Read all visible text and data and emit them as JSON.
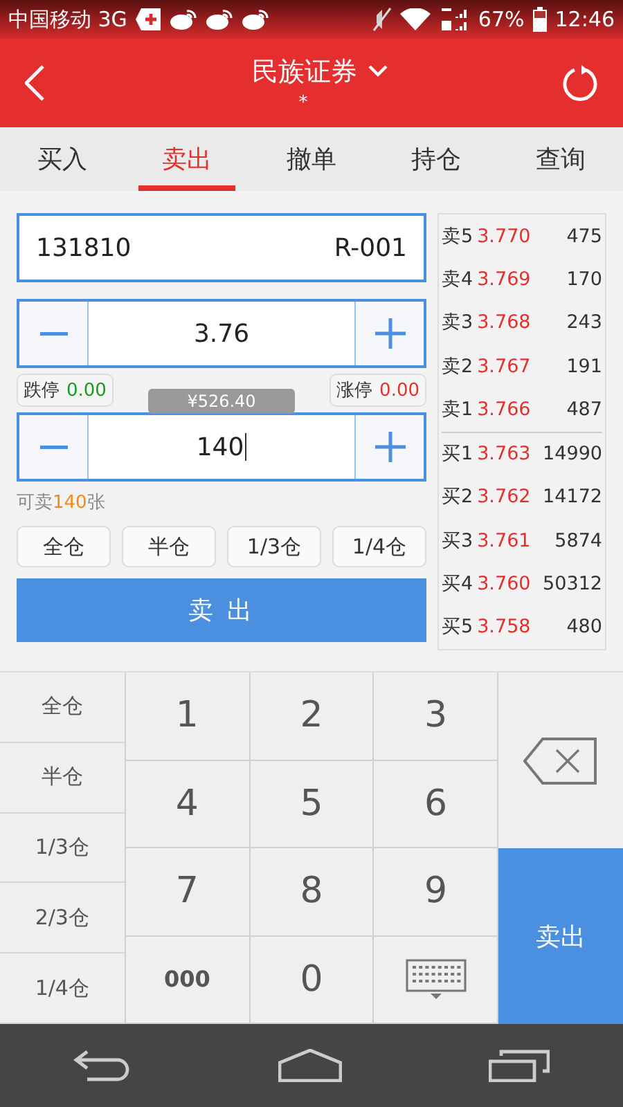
{
  "status_bar": {
    "carrier": "中国移动 3G",
    "battery": "67%",
    "time": "12:46"
  },
  "header": {
    "title": "民族证券",
    "subtitle": "*"
  },
  "tabs": [
    {
      "label": "买入",
      "selected": false
    },
    {
      "label": "卖出",
      "selected": true
    },
    {
      "label": "撤单",
      "selected": false
    },
    {
      "label": "持仓",
      "selected": false
    },
    {
      "label": "查询",
      "selected": false
    }
  ],
  "order": {
    "stock_code": "131810",
    "stock_name": "R-001",
    "price": "3.76",
    "limit_down": {
      "label": "跌停",
      "value": "0.00"
    },
    "limit_up": {
      "label": "涨停",
      "value": "0.00"
    },
    "amount_tooltip": "¥526.40",
    "quantity": "140",
    "available": {
      "prefix": "可卖",
      "count": "140",
      "suffix": "张"
    },
    "position_buttons": [
      "全仓",
      "半仓",
      "1/3仓",
      "1/4仓"
    ],
    "sell_button": "卖 出"
  },
  "order_book": {
    "asks": [
      {
        "label": "卖5",
        "price": "3.770",
        "volume": "475"
      },
      {
        "label": "卖4",
        "price": "3.769",
        "volume": "170"
      },
      {
        "label": "卖3",
        "price": "3.768",
        "volume": "243"
      },
      {
        "label": "卖2",
        "price": "3.767",
        "volume": "191"
      },
      {
        "label": "卖1",
        "price": "3.766",
        "volume": "487"
      }
    ],
    "bids": [
      {
        "label": "买1",
        "price": "3.763",
        "volume": "14990"
      },
      {
        "label": "买2",
        "price": "3.762",
        "volume": "14172"
      },
      {
        "label": "买3",
        "price": "3.761",
        "volume": "5874"
      },
      {
        "label": "买4",
        "price": "3.760",
        "volume": "50312"
      },
      {
        "label": "买5",
        "price": "3.758",
        "volume": "480"
      }
    ]
  },
  "keypad": {
    "side_keys": [
      "全仓",
      "半仓",
      "1/3仓",
      "2/3仓",
      "1/4仓"
    ],
    "keys": [
      {
        "kind": "digit",
        "label": "1"
      },
      {
        "kind": "digit",
        "label": "2"
      },
      {
        "kind": "digit",
        "label": "3"
      },
      {
        "kind": "digit",
        "label": "4"
      },
      {
        "kind": "digit",
        "label": "5"
      },
      {
        "kind": "digit",
        "label": "6"
      },
      {
        "kind": "digit",
        "label": "7"
      },
      {
        "kind": "digit",
        "label": "8"
      },
      {
        "kind": "digit",
        "label": "9"
      },
      {
        "kind": "bold",
        "label": "000"
      },
      {
        "kind": "digit",
        "label": "0"
      },
      {
        "kind": "keyboard"
      }
    ],
    "sell_key": "卖出"
  }
}
